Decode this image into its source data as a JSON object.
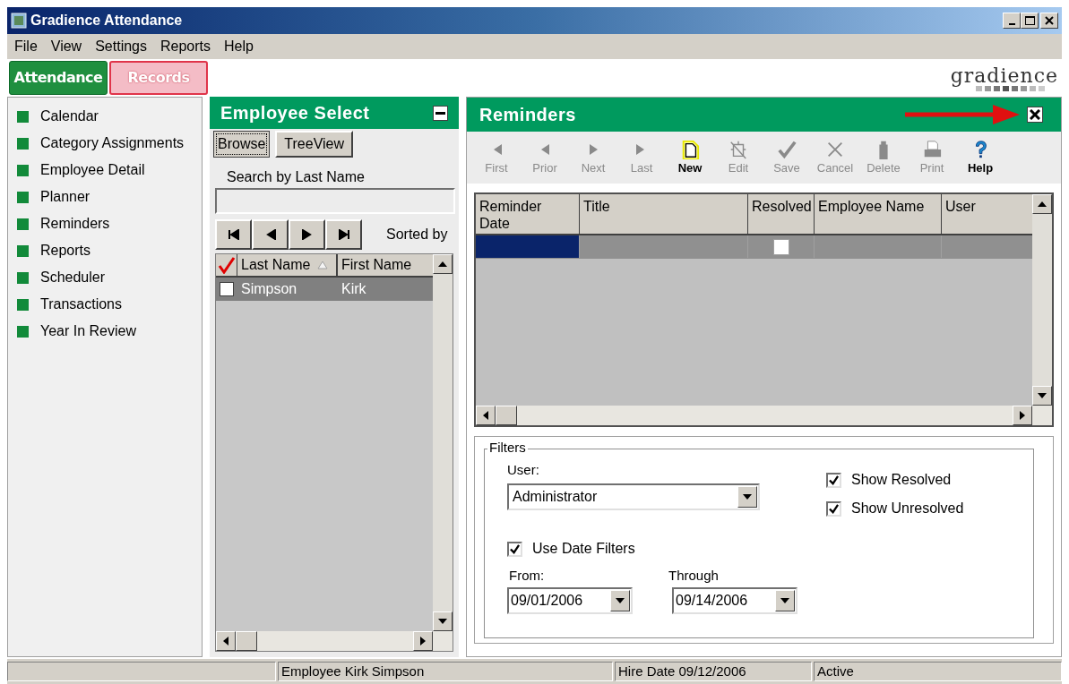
{
  "window": {
    "title": "Gradience Attendance"
  },
  "menu": [
    "File",
    "View",
    "Settings",
    "Reports",
    "Help"
  ],
  "tabs": [
    {
      "label": "Attendance",
      "selected": true
    },
    {
      "label": "Records",
      "selected": false
    }
  ],
  "logo": "gradience",
  "sidebar": {
    "items": [
      "Calendar",
      "Category Assignments",
      "Employee Detail",
      "Planner",
      "Reminders",
      "Reports",
      "Scheduler",
      "Transactions",
      "Year In Review"
    ]
  },
  "employee_select": {
    "title": "Employee Select",
    "views": [
      {
        "label": "Browse",
        "selected": true
      },
      {
        "label": "TreeView",
        "selected": false
      }
    ],
    "search_label": "Search by Last Name",
    "sorted_label": "Sorted by",
    "columns": [
      "Last Name",
      "First Name"
    ],
    "rows": [
      {
        "last_name": "Simpson",
        "first_name": "Kirk",
        "checked": false,
        "selected": true
      }
    ]
  },
  "reminders": {
    "title": "Reminders",
    "toolbar": [
      {
        "kind": "first",
        "label": "First",
        "disabled": true
      },
      {
        "kind": "prior",
        "label": "Prior",
        "disabled": true
      },
      {
        "kind": "next",
        "label": "Next",
        "disabled": true
      },
      {
        "kind": "last",
        "label": "Last",
        "disabled": true
      },
      {
        "kind": "new",
        "label": "New",
        "disabled": false
      },
      {
        "kind": "edit",
        "label": "Edit",
        "disabled": true
      },
      {
        "kind": "save",
        "label": "Save",
        "disabled": true
      },
      {
        "kind": "cancel",
        "label": "Cancel",
        "disabled": true
      },
      {
        "kind": "delete",
        "label": "Delete",
        "disabled": true
      },
      {
        "kind": "print",
        "label": "Print",
        "disabled": true
      },
      {
        "kind": "help",
        "label": "Help",
        "disabled": false
      }
    ],
    "columns": [
      "Reminder Date",
      "Title",
      "Resolved",
      "Employee Name",
      "User"
    ],
    "rows": [
      {
        "resolved": false,
        "selected": true
      }
    ],
    "filters": {
      "legend": "Filters",
      "user_label": "User:",
      "user_value": "Administrator",
      "show_resolved": {
        "label": "Show Resolved",
        "checked": true
      },
      "show_unresolved": {
        "label": "Show Unresolved",
        "checked": true
      },
      "use_date_filters": {
        "label": "Use Date Filters",
        "checked": true
      },
      "from_label": "From:",
      "from_value": "09/01/2006",
      "through_label": "Through",
      "through_value": "09/14/2006"
    }
  },
  "status_bar": [
    "Employee Kirk  Simpson",
    "Hire Date 09/12/2006",
    "Active"
  ]
}
